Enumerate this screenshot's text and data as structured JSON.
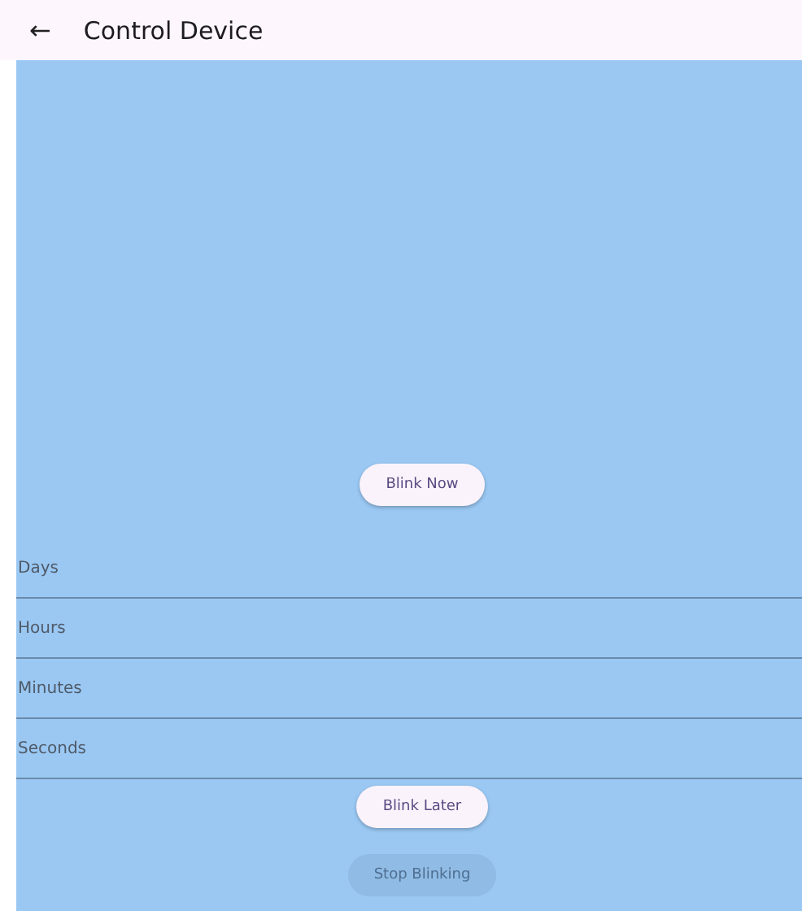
{
  "app_bar": {
    "back_icon": "←",
    "title": "Control Device"
  },
  "blink_now": {
    "label": "Blink Now",
    "disabled": false
  },
  "fields": [
    {
      "placeholder": "Days"
    },
    {
      "placeholder": "Hours"
    },
    {
      "placeholder": "Minutes"
    },
    {
      "placeholder": "Seconds"
    }
  ],
  "buttons": [
    {
      "label": "Blink Later",
      "disabled": false
    },
    {
      "label": "Stop Blinking",
      "disabled": true
    }
  ]
}
